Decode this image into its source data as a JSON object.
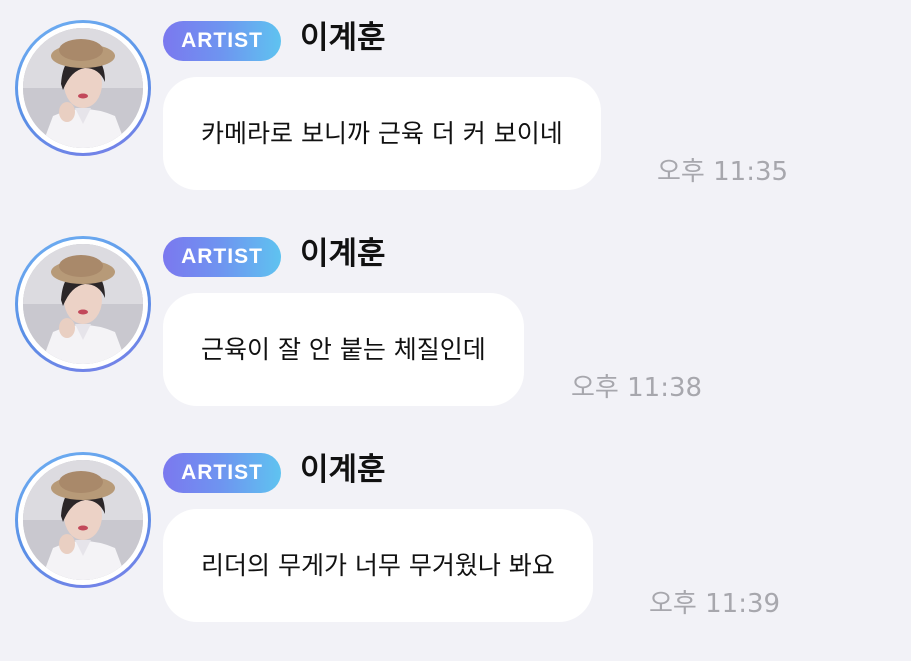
{
  "messages": [
    {
      "badge": "ARTIST",
      "sender": "이계훈",
      "text": "카메라로 보니까 근육 더 커 보이네",
      "time": "오후 11:35"
    },
    {
      "badge": "ARTIST",
      "sender": "이계훈",
      "text": "근육이 잘 안 붙는 체질인데",
      "time": "오후 11:38"
    },
    {
      "badge": "ARTIST",
      "sender": "이계훈",
      "text": "리더의 무게가 너무 무거웠나 봐요",
      "time": "오후 11:39"
    }
  ],
  "colors": {
    "background": "#f2f2f7",
    "bubble": "#ffffff",
    "badge_gradient_start": "#7b78ef",
    "badge_gradient_end": "#5fc3f0",
    "avatar_ring": "#6fb0f2",
    "timestamp": "#a7a7ad"
  },
  "icons": {
    "avatar": "profile-photo"
  }
}
